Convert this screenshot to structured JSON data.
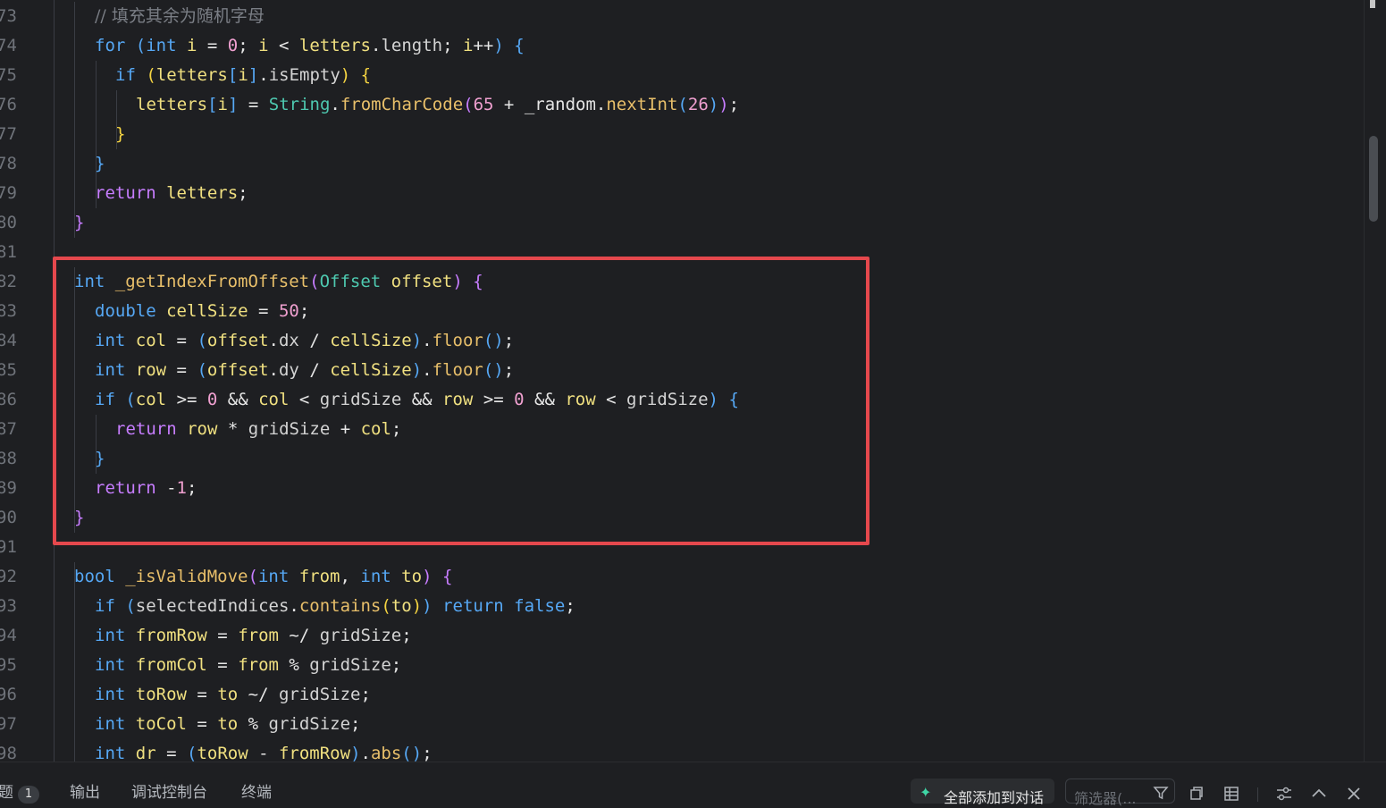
{
  "editor": {
    "lines": [
      {
        "n": "73",
        "tokens": [
          [
            "cmt",
            "// 填充其余为随机字母"
          ]
        ]
      },
      {
        "n": "74",
        "tokens": [
          [
            "kw",
            "for"
          ],
          [
            "plain",
            " "
          ],
          [
            "pb2",
            "("
          ],
          [
            "kw",
            "int"
          ],
          [
            "plain",
            " "
          ],
          [
            "id",
            "i"
          ],
          [
            "plain",
            " = "
          ],
          [
            "num",
            "0"
          ],
          [
            "plain",
            "; "
          ],
          [
            "id",
            "i"
          ],
          [
            "plain",
            " < "
          ],
          [
            "id",
            "letters"
          ],
          [
            "plain",
            "."
          ],
          [
            "member",
            "length"
          ],
          [
            "plain",
            "; "
          ],
          [
            "id",
            "i"
          ],
          [
            "plain",
            "++"
          ],
          [
            "pb2",
            ")"
          ],
          [
            "plain",
            " "
          ],
          [
            "pb2",
            "{"
          ]
        ]
      },
      {
        "n": "75",
        "tokens": [
          [
            "kw",
            "if"
          ],
          [
            "plain",
            " "
          ],
          [
            "pb3",
            "("
          ],
          [
            "id",
            "letters"
          ],
          [
            "pb2",
            "["
          ],
          [
            "id",
            "i"
          ],
          [
            "pb2",
            "]"
          ],
          [
            "plain",
            "."
          ],
          [
            "member",
            "isEmpty"
          ],
          [
            "pb3",
            ")"
          ],
          [
            "plain",
            " "
          ],
          [
            "pb3",
            "{"
          ]
        ]
      },
      {
        "n": "76",
        "tokens": [
          [
            "id",
            "letters"
          ],
          [
            "pb2",
            "["
          ],
          [
            "id",
            "i"
          ],
          [
            "pb2",
            "]"
          ],
          [
            "plain",
            " = "
          ],
          [
            "type",
            "String"
          ],
          [
            "plain",
            "."
          ],
          [
            "fn",
            "fromCharCode"
          ],
          [
            "pb1",
            "("
          ],
          [
            "num",
            "65"
          ],
          [
            "plain",
            " + "
          ],
          [
            "plain",
            "_random"
          ],
          [
            "plain",
            "."
          ],
          [
            "fn",
            "nextInt"
          ],
          [
            "pb2",
            "("
          ],
          [
            "num",
            "26"
          ],
          [
            "pb2",
            ")"
          ],
          [
            "pb1",
            ")"
          ],
          [
            "plain",
            ";"
          ]
        ]
      },
      {
        "n": "77",
        "tokens": [
          [
            "pb3",
            "}"
          ]
        ]
      },
      {
        "n": "78",
        "tokens": [
          [
            "pb2",
            "}"
          ]
        ]
      },
      {
        "n": "79",
        "tokens": [
          [
            "kw2",
            "return"
          ],
          [
            "plain",
            " "
          ],
          [
            "id",
            "letters"
          ],
          [
            "plain",
            ";"
          ]
        ]
      },
      {
        "n": "80",
        "tokens": [
          [
            "pb1",
            "}"
          ]
        ]
      },
      {
        "n": "81",
        "tokens": []
      },
      {
        "n": "82",
        "tokens": [
          [
            "kw",
            "int"
          ],
          [
            "plain",
            " "
          ],
          [
            "fn",
            "_getIndexFromOffset"
          ],
          [
            "pb1",
            "("
          ],
          [
            "type",
            "Offset"
          ],
          [
            "plain",
            " "
          ],
          [
            "id",
            "offset"
          ],
          [
            "pb1",
            ")"
          ],
          [
            "plain",
            " "
          ],
          [
            "pb1",
            "{"
          ]
        ]
      },
      {
        "n": "83",
        "tokens": [
          [
            "kw",
            "double"
          ],
          [
            "plain",
            " "
          ],
          [
            "id",
            "cellSize"
          ],
          [
            "plain",
            " = "
          ],
          [
            "num",
            "50"
          ],
          [
            "plain",
            ";"
          ]
        ]
      },
      {
        "n": "84",
        "tokens": [
          [
            "kw",
            "int"
          ],
          [
            "plain",
            " "
          ],
          [
            "id",
            "col"
          ],
          [
            "plain",
            " = "
          ],
          [
            "pb2",
            "("
          ],
          [
            "id",
            "offset"
          ],
          [
            "plain",
            "."
          ],
          [
            "member",
            "dx"
          ],
          [
            "plain",
            " / "
          ],
          [
            "id",
            "cellSize"
          ],
          [
            "pb2",
            ")"
          ],
          [
            "plain",
            "."
          ],
          [
            "fn",
            "floor"
          ],
          [
            "pb2",
            "()"
          ],
          [
            "plain",
            ";"
          ]
        ]
      },
      {
        "n": "85",
        "tokens": [
          [
            "kw",
            "int"
          ],
          [
            "plain",
            " "
          ],
          [
            "id",
            "row"
          ],
          [
            "plain",
            " = "
          ],
          [
            "pb2",
            "("
          ],
          [
            "id",
            "offset"
          ],
          [
            "plain",
            "."
          ],
          [
            "member",
            "dy"
          ],
          [
            "plain",
            " / "
          ],
          [
            "id",
            "cellSize"
          ],
          [
            "pb2",
            ")"
          ],
          [
            "plain",
            "."
          ],
          [
            "fn",
            "floor"
          ],
          [
            "pb2",
            "()"
          ],
          [
            "plain",
            ";"
          ]
        ]
      },
      {
        "n": "86",
        "tokens": [
          [
            "kw",
            "if"
          ],
          [
            "plain",
            " "
          ],
          [
            "pb2",
            "("
          ],
          [
            "id",
            "col"
          ],
          [
            "plain",
            " >= "
          ],
          [
            "num",
            "0"
          ],
          [
            "plain",
            " && "
          ],
          [
            "id",
            "col"
          ],
          [
            "plain",
            " < "
          ],
          [
            "member",
            "gridSize"
          ],
          [
            "plain",
            " && "
          ],
          [
            "id",
            "row"
          ],
          [
            "plain",
            " >= "
          ],
          [
            "num",
            "0"
          ],
          [
            "plain",
            " && "
          ],
          [
            "id",
            "row"
          ],
          [
            "plain",
            " < "
          ],
          [
            "member",
            "gridSize"
          ],
          [
            "pb2",
            ")"
          ],
          [
            "plain",
            " "
          ],
          [
            "pb2",
            "{"
          ]
        ]
      },
      {
        "n": "87",
        "tokens": [
          [
            "kw2",
            "return"
          ],
          [
            "plain",
            " "
          ],
          [
            "id",
            "row"
          ],
          [
            "plain",
            " * "
          ],
          [
            "member",
            "gridSize"
          ],
          [
            "plain",
            " + "
          ],
          [
            "id",
            "col"
          ],
          [
            "plain",
            ";"
          ]
        ]
      },
      {
        "n": "88",
        "tokens": [
          [
            "pb2",
            "}"
          ]
        ]
      },
      {
        "n": "89",
        "tokens": [
          [
            "kw2",
            "return"
          ],
          [
            "plain",
            " -"
          ],
          [
            "num",
            "1"
          ],
          [
            "plain",
            ";"
          ]
        ]
      },
      {
        "n": "90",
        "tokens": [
          [
            "pb1",
            "}"
          ]
        ]
      },
      {
        "n": "91",
        "tokens": []
      },
      {
        "n": "92",
        "tokens": [
          [
            "kw",
            "bool"
          ],
          [
            "plain",
            " "
          ],
          [
            "fn",
            "_isValidMove"
          ],
          [
            "pb1",
            "("
          ],
          [
            "kw",
            "int"
          ],
          [
            "plain",
            " "
          ],
          [
            "id",
            "from"
          ],
          [
            "plain",
            ", "
          ],
          [
            "kw",
            "int"
          ],
          [
            "plain",
            " "
          ],
          [
            "id",
            "to"
          ],
          [
            "pb1",
            ")"
          ],
          [
            "plain",
            " "
          ],
          [
            "pb1",
            "{"
          ]
        ]
      },
      {
        "n": "93",
        "tokens": [
          [
            "kw",
            "if"
          ],
          [
            "plain",
            " "
          ],
          [
            "pb2",
            "("
          ],
          [
            "member",
            "selectedIndices"
          ],
          [
            "plain",
            "."
          ],
          [
            "fn",
            "contains"
          ],
          [
            "pb3",
            "("
          ],
          [
            "id",
            "to"
          ],
          [
            "pb3",
            ")"
          ],
          [
            "pb2",
            ")"
          ],
          [
            "plain",
            " "
          ],
          [
            "kw",
            "return"
          ],
          [
            "plain",
            " "
          ],
          [
            "kw",
            "false"
          ],
          [
            "plain",
            ";"
          ]
        ]
      },
      {
        "n": "94",
        "tokens": [
          [
            "kw",
            "int"
          ],
          [
            "plain",
            " "
          ],
          [
            "id",
            "fromRow"
          ],
          [
            "plain",
            " = "
          ],
          [
            "id",
            "from"
          ],
          [
            "plain",
            " ~/ "
          ],
          [
            "member",
            "gridSize"
          ],
          [
            "plain",
            ";"
          ]
        ]
      },
      {
        "n": "95",
        "tokens": [
          [
            "kw",
            "int"
          ],
          [
            "plain",
            " "
          ],
          [
            "id",
            "fromCol"
          ],
          [
            "plain",
            " = "
          ],
          [
            "id",
            "from"
          ],
          [
            "plain",
            " % "
          ],
          [
            "member",
            "gridSize"
          ],
          [
            "plain",
            ";"
          ]
        ]
      },
      {
        "n": "96",
        "tokens": [
          [
            "kw",
            "int"
          ],
          [
            "plain",
            " "
          ],
          [
            "id",
            "toRow"
          ],
          [
            "plain",
            " = "
          ],
          [
            "id",
            "to"
          ],
          [
            "plain",
            " ~/ "
          ],
          [
            "member",
            "gridSize"
          ],
          [
            "plain",
            ";"
          ]
        ]
      },
      {
        "n": "97",
        "tokens": [
          [
            "kw",
            "int"
          ],
          [
            "plain",
            " "
          ],
          [
            "id",
            "toCol"
          ],
          [
            "plain",
            " = "
          ],
          [
            "id",
            "to"
          ],
          [
            "plain",
            " % "
          ],
          [
            "member",
            "gridSize"
          ],
          [
            "plain",
            ";"
          ]
        ]
      },
      {
        "n": "98",
        "tokens": [
          [
            "kw",
            "int"
          ],
          [
            "plain",
            " "
          ],
          [
            "id",
            "dr"
          ],
          [
            "plain",
            " = "
          ],
          [
            "pb2",
            "("
          ],
          [
            "id",
            "toRow"
          ],
          [
            "plain",
            " - "
          ],
          [
            "id",
            "fromRow"
          ],
          [
            "pb2",
            ")"
          ],
          [
            "plain",
            "."
          ],
          [
            "fn",
            "abs"
          ],
          [
            "pb2",
            "()"
          ],
          [
            "plain",
            ";"
          ]
        ]
      }
    ]
  },
  "panel": {
    "tabs": [
      {
        "label": "题",
        "badge": "1"
      },
      {
        "label": "输出"
      },
      {
        "label": "调试控制台"
      },
      {
        "label": "终端"
      }
    ],
    "add_all_label": "全部添加到对话",
    "filter_placeholder": "筛选器(...",
    "icons": [
      "funnel-icon",
      "copy-icon",
      "list-icon",
      "settings-icon",
      "chevron-up-icon",
      "close-icon"
    ]
  },
  "colors": {
    "highlight_border": "#e5484d",
    "background": "#1e1f22",
    "spark": "#3fd6a6"
  }
}
